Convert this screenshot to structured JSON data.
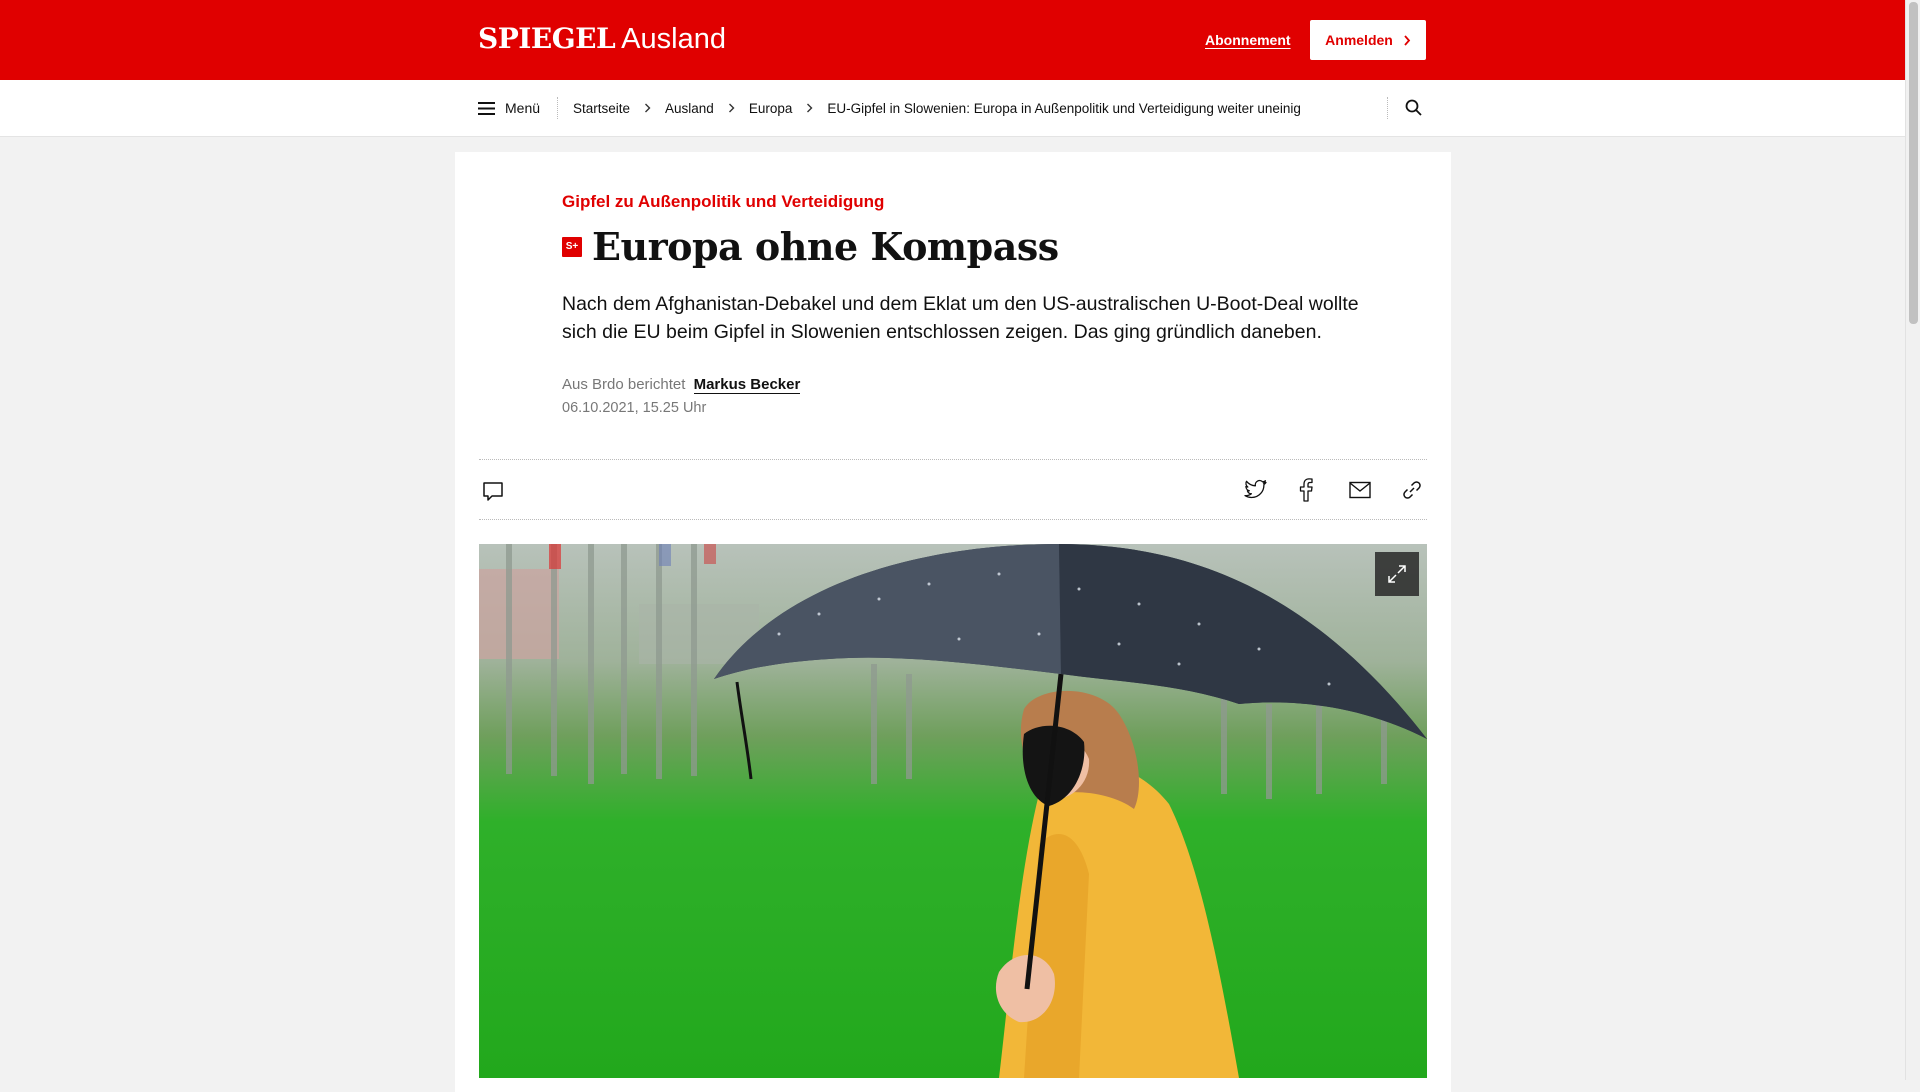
{
  "header": {
    "logo": "SPIEGEL",
    "section": "Ausland",
    "subscription_link": "Abonnement",
    "login_button": "Anmelden",
    "brand_color": "#e00000"
  },
  "nav": {
    "menu_label": "Menü",
    "breadcrumbs": [
      "Startseite",
      "Ausland",
      "Europa",
      "EU-Gipfel in Slowenien: Europa in Außenpolitik und Verteidigung weiter uneinig"
    ],
    "search_icon": "search-icon"
  },
  "article": {
    "kicker": "Gipfel zu Außenpolitik und Verteidigung",
    "premium_badge": "S+",
    "headline": "Europa ohne Kompass",
    "teaser": "Nach dem Afghanistan-Debakel und dem Eklat um den US-australischen U-Boot-Deal wollte sich die EU beim Gipfel in Slowenien entschlossen zeigen. Das ging gründlich daneben.",
    "byline_prefix": "Aus Brdo berichtet",
    "author": "Markus Becker",
    "date": "06.10.2021, 15.25 Uhr"
  },
  "share_bar": {
    "left_icons": [
      "comment-icon"
    ],
    "right_icons": [
      "twitter-icon",
      "facebook-icon",
      "mail-icon",
      "link-icon"
    ]
  },
  "hero_image": {
    "expand_icon": "expand-icon"
  }
}
